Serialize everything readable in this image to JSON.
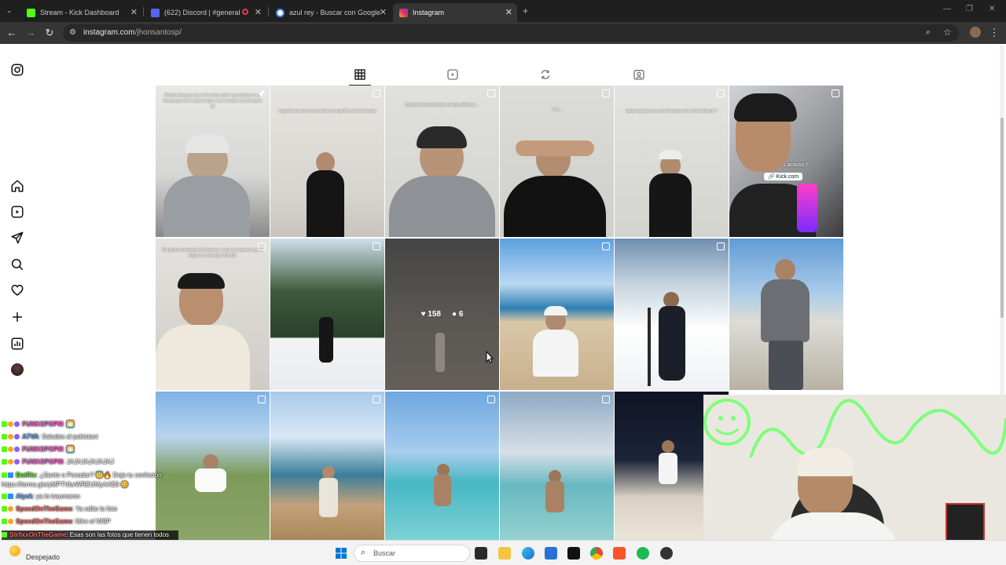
{
  "browser": {
    "tabs": [
      {
        "title": "Stream - Kick Dashboard",
        "color": "#53fc18"
      },
      {
        "title": "(622) Discord | #general",
        "color": "#5865f2"
      },
      {
        "title": "azul rey - Buscar con Google",
        "color": "#4285f4"
      },
      {
        "title": "Instagram",
        "color": "#e1306c"
      }
    ],
    "url_host": "instagram.com",
    "url_path": "/jhonsantosp/"
  },
  "instagram": {
    "sidebar_icons": [
      "instagram-logo-icon",
      "home-icon",
      "reels-icon",
      "messages-icon",
      "search-icon",
      "notifications-icon",
      "create-icon",
      "dashboard-icon",
      "profile-avatar"
    ],
    "profile_tabs": [
      "posts-grid-icon",
      "reels-tab-icon",
      "reposts-tab-icon",
      "tagged-tab-icon"
    ],
    "posts": [
      {
        "caption": "Repéte despues de mi\nNo debo darle oportunidad a un feo porque se le sube el ego y se le acaba si la fea fuera yo",
        "type": "pinned"
      },
      {
        "caption": "Cuando el nuevo novio entra a mi perfil a verme de pies",
        "type": "reel"
      },
      {
        "caption": "Cuando me preguntan si tengo defectos ...",
        "type": "reel"
      },
      {
        "caption": "Y si...",
        "type": "reel"
      },
      {
        "caption": "Sabes quienes no van de tonan este 14 de febrero ?",
        "type": "reel"
      },
      {
        "caption": "Estamos activos !!",
        "type": "reel",
        "link": "Kick.com"
      },
      {
        "caption": "El impulso tremendo de bloquear a aun asi esperar que le llegue un mensaje diciendo",
        "type": "reel"
      },
      {
        "caption": "",
        "type": "carousel"
      },
      {
        "caption": "",
        "type": "photo",
        "likes": "158",
        "comments": "6"
      },
      {
        "caption": "",
        "type": "carousel"
      },
      {
        "caption": "",
        "type": "carousel"
      },
      {
        "caption": "",
        "type": "photo"
      },
      {
        "caption": "",
        "type": "carousel"
      },
      {
        "caption": "",
        "type": "carousel"
      },
      {
        "caption": "",
        "type": "carousel"
      },
      {
        "caption": "",
        "type": "carousel"
      },
      {
        "caption": "",
        "type": "photo"
      }
    ]
  },
  "chat": {
    "messages": [
      {
        "user": "FUNKOPOPIII",
        "text": ": 🌅",
        "color": "#ff5fd2"
      },
      {
        "user": "A7VA",
        "text": ": Saludos al pakistani",
        "color": "#4da6ff"
      },
      {
        "user": "FUNKOPOPIII",
        "text": ": 🌅",
        "color": "#ff5fd2"
      },
      {
        "user": "FUNKOPOPIII",
        "text": ": JAJAJAJAJAJAJ",
        "color": "#ff5fd2"
      },
      {
        "user": "BotRix",
        "text": ": ¿Santo o Pecador? 😇🔥 Deja tu confesión: https://forms.gle/yMPTVbvWREUMyAAE9 😊",
        "color": "#53fc18"
      },
      {
        "user": "Alyck",
        "text": ": ya lo traumaron",
        "color": "#6fa8ff"
      },
      {
        "user": "SpeedOnTheGame",
        "text": ": Ya edite la foto",
        "color": "#ff6b6b"
      },
      {
        "user": "SpeedOnTheGame",
        "text": ": Mire el WSP",
        "color": "#ff6b6b"
      },
      {
        "user": "Str0xxOnTheGame",
        "text": ": Esas son las fotos que tienen todos mis panas gays",
        "color": "#ff6b6b"
      }
    ]
  },
  "taskbar": {
    "weather": "Despejado",
    "search_placeholder": "Buscar"
  }
}
